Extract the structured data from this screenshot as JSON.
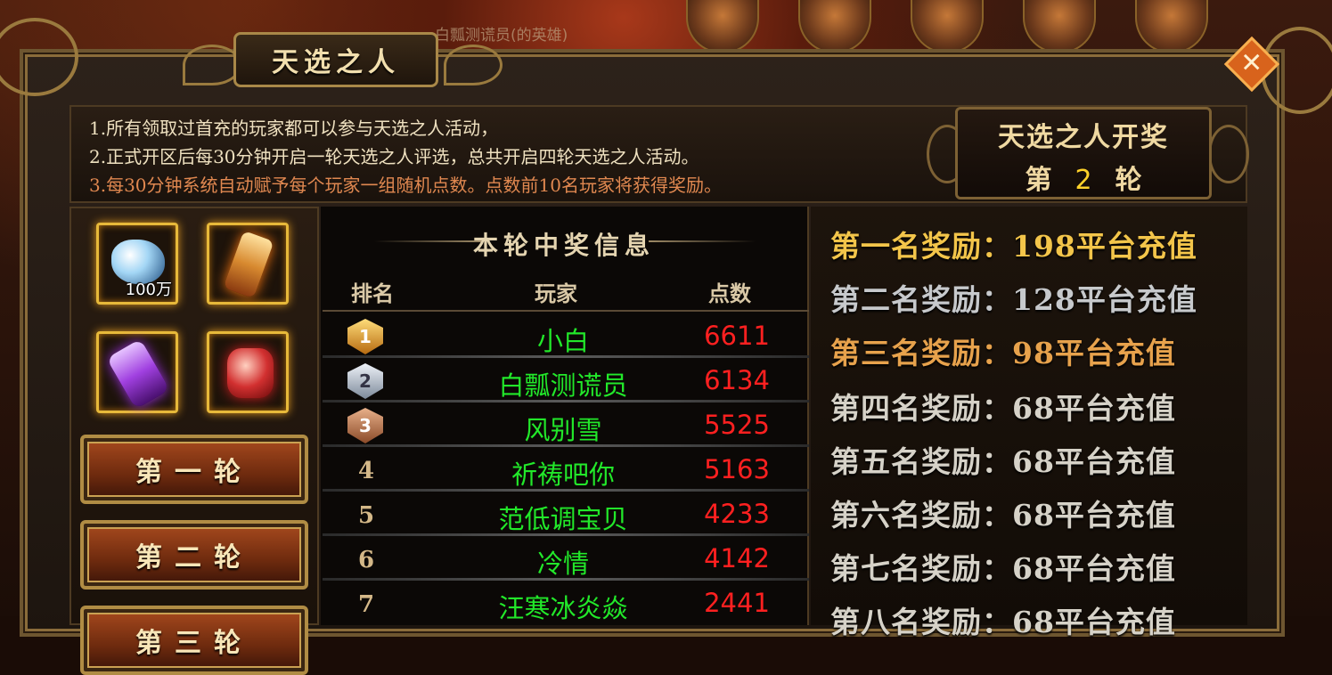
{
  "background_hint": "白瓢测谎员(的英雄)",
  "window_title": "天选之人",
  "close_label": "✕",
  "rules": [
    "1.所有领取过首充的玩家都可以参与天选之人活动，",
    "2.正式开区后每30分钟开启一轮天选之人评选，总共开启四轮天选之人活动。",
    "3.每30分钟系统自动赋予每个玩家一组随机点数。点数前10名玩家将获得奖励。"
  ],
  "draw_box": {
    "title": "天选之人开奖",
    "round_prefix": "第",
    "round_number": "2",
    "round_suffix": "轮"
  },
  "reward_items": [
    {
      "icon": "diamond-icon",
      "qty": "100万"
    },
    {
      "icon": "firework-icon",
      "qty": ""
    },
    {
      "icon": "purple-scroll-icon",
      "qty": ""
    },
    {
      "icon": "red-scroll-icon",
      "qty": ""
    }
  ],
  "round_buttons": [
    "第一轮",
    "第二轮",
    "第三轮"
  ],
  "winners": {
    "title": "本轮中奖信息",
    "columns": [
      "排名",
      "玩家",
      "点数"
    ],
    "rows": [
      {
        "rank": "1",
        "medal": "gold",
        "player": "小白",
        "points": "6611"
      },
      {
        "rank": "2",
        "medal": "silver",
        "player": "白瓢测谎员",
        "points": "6134"
      },
      {
        "rank": "3",
        "medal": "bronze",
        "player": "风别雪",
        "points": "5525"
      },
      {
        "rank": "4",
        "medal": "",
        "player": "祈祷吧你",
        "points": "5163"
      },
      {
        "rank": "5",
        "medal": "",
        "player": "范低调宝贝",
        "points": "4233"
      },
      {
        "rank": "6",
        "medal": "",
        "player": "冷情",
        "points": "4142"
      },
      {
        "rank": "7",
        "medal": "",
        "player": "汪寒冰炎焱",
        "points": "2441"
      }
    ]
  },
  "prizes": [
    "第一名奖励：198平台充值",
    "第二名奖励：128平台充值",
    "第三名奖励：98平台充值",
    "第四名奖励：68平台充值",
    "第五名奖励：68平台充值",
    "第六名奖励：68平台充值",
    "第七名奖励：68平台充值",
    "第八名奖励：68平台充值"
  ],
  "colors": {
    "player_name": "#22e82a",
    "points": "#ff2020",
    "prize_first": "#f3c54a",
    "prize_second": "#c7c9cc",
    "prize_third": "#e7a24c",
    "round_number": "#ffd22a"
  }
}
